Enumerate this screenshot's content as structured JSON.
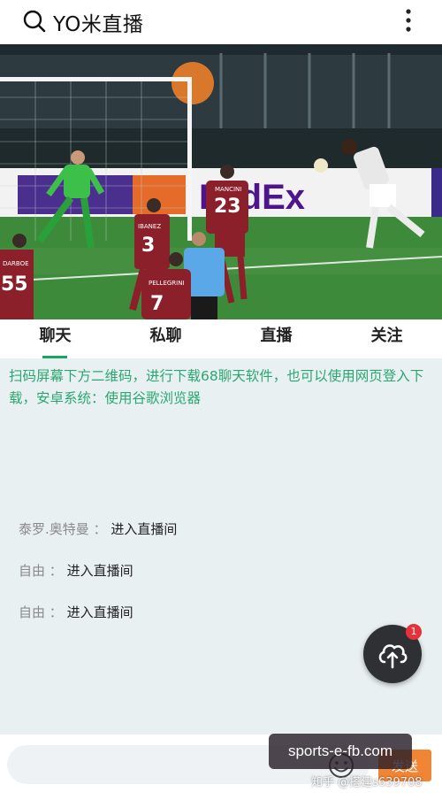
{
  "header": {
    "title": "YO米直播",
    "search_icon": "search-icon",
    "menu_icon": "more-vertical-icon"
  },
  "video": {
    "description_icon": "live-video-frame",
    "jersey_numbers": [
      "55",
      "3",
      "23",
      "7"
    ],
    "jersey_names": [
      "DARBOE",
      "IBANEZ",
      "MANCINI",
      "PELLEGRINI"
    ],
    "ad_text": "FedEx"
  },
  "tabs": [
    {
      "label": "聊天",
      "active": true
    },
    {
      "label": "私聊",
      "active": false
    },
    {
      "label": "直播",
      "active": false
    },
    {
      "label": "关注",
      "active": false
    }
  ],
  "chat": {
    "notice": "扫码屏幕下方二维码，进行下载68聊天软件，也可以使用网页登入下载，安卓系统：使用谷歌浏览器",
    "messages": [
      {
        "user": "泰罗.奥特曼",
        "sep": "：",
        "text": "进入直播间"
      },
      {
        "user": "自由",
        "sep": "：",
        "text": "进入直播间"
      },
      {
        "user": "自由",
        "sep": "：",
        "text": "进入直播间"
      }
    ]
  },
  "fab": {
    "icon": "cloud-upload-icon",
    "badge_count": "1"
  },
  "composer": {
    "placeholder": "",
    "send_label": "发送",
    "emoji_icon": "emoji-icon"
  },
  "watermarks": {
    "site": "sports-e-fb.com",
    "zhihu": "知乎 @搭建s639708"
  },
  "colors": {
    "accent": "#1ba563",
    "notice_text": "#2aa771",
    "send_button": "#f08536",
    "fab": "#2f3033",
    "badge": "#e6313a"
  }
}
